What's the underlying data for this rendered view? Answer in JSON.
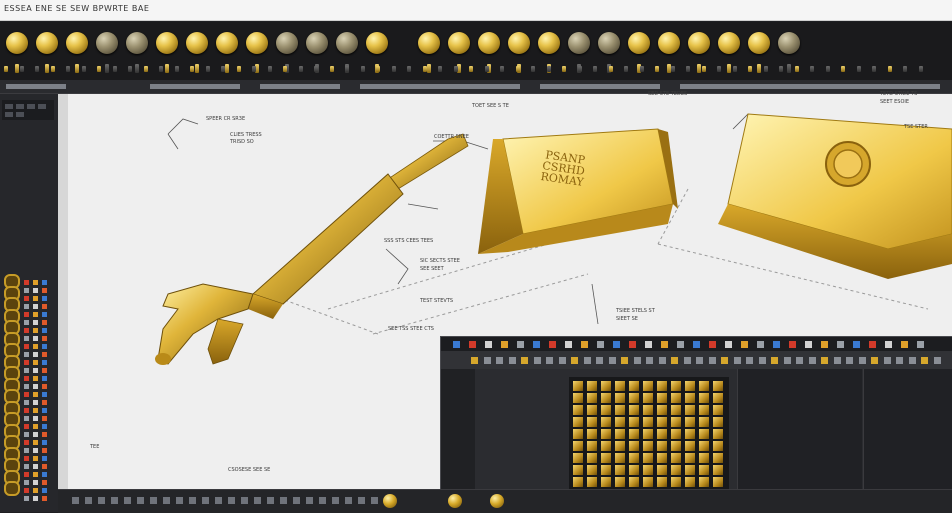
{
  "window": {
    "title": "ESSEA ENE SE SEW BPWRTE BAE"
  },
  "toolbar": {
    "buttons": [
      {
        "icon": "gold-sphere-icon",
        "style": "gold"
      },
      {
        "icon": "gold-sphere-icon",
        "style": "gold"
      },
      {
        "icon": "gold-sphere-icon",
        "style": "gold"
      },
      {
        "icon": "gold-sphere-icon",
        "style": "dim"
      },
      {
        "icon": "gold-sphere-icon",
        "style": "dim"
      },
      {
        "icon": "gold-sphere-icon",
        "style": "gold"
      },
      {
        "icon": "gold-sphere-icon",
        "style": "gold"
      },
      {
        "icon": "gold-sphere-icon",
        "style": "gold"
      },
      {
        "icon": "gold-sphere-icon",
        "style": "gold"
      },
      {
        "icon": "gold-sphere-icon",
        "style": "dim"
      },
      {
        "icon": "gold-sphere-icon",
        "style": "dim"
      },
      {
        "icon": "gold-sphere-icon",
        "style": "dim"
      },
      {
        "icon": "gold-sphere-icon",
        "style": "gold"
      },
      {
        "icon": "gold-sphere-icon",
        "style": "gold"
      },
      {
        "icon": "gold-sphere-icon",
        "style": "gold"
      },
      {
        "icon": "gold-sphere-icon",
        "style": "gold"
      },
      {
        "icon": "gold-sphere-icon",
        "style": "gold"
      },
      {
        "icon": "gold-sphere-icon",
        "style": "gold"
      },
      {
        "icon": "gold-sphere-icon",
        "style": "dim"
      },
      {
        "icon": "gold-sphere-icon",
        "style": "dim"
      },
      {
        "icon": "gold-sphere-icon",
        "style": "gold"
      },
      {
        "icon": "gold-sphere-icon",
        "style": "gold"
      },
      {
        "icon": "gold-sphere-icon",
        "style": "gold"
      },
      {
        "icon": "gold-sphere-icon",
        "style": "gold"
      },
      {
        "icon": "gold-sphere-icon",
        "style": "gold"
      },
      {
        "icon": "gold-sphere-icon",
        "style": "dim"
      }
    ]
  },
  "canvas": {
    "stamp_lines": [
      "PSANP",
      "CSRHD",
      "ROMAY"
    ],
    "annotations": [
      "SPEER CR SR3E",
      "CLIES TRESS",
      "TRISD SO",
      "COETTR SNEE",
      "TOET SEE S TE",
      "SED STE TEDES",
      "TETD STIDE TS",
      "SEET ESOIE",
      "TSE STER",
      "SSS STS CEES TEES",
      "SIC SECTS STEE",
      "SEE SEET",
      "TEST STEVTS",
      "TSIEE STELS ST",
      "SIEET SE",
      "SEE TSS STEE CTS",
      "TEE",
      "CSOSESE SEE SE"
    ]
  },
  "colors": {
    "gold_light": "#fff2a6",
    "gold_mid": "#e0b53a",
    "gold_dark": "#7a5a0c",
    "canvas_bg": "#efefef",
    "panel_bg": "#26272b"
  }
}
